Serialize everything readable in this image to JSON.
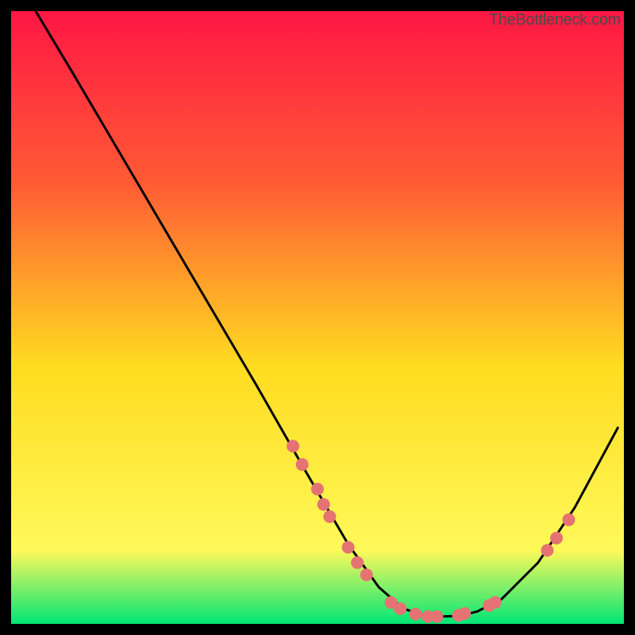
{
  "watermark": "TheBottleneck.com",
  "chart_data": {
    "type": "line",
    "title": "",
    "xlabel": "",
    "ylabel": "",
    "xlim": [
      0,
      100
    ],
    "ylim": [
      0,
      100
    ],
    "grid": false,
    "legend": false,
    "gradient_background": {
      "top_color": "#ff1744",
      "mid_top_color": "#ff5b34",
      "mid_color": "#ffdc20",
      "mid_bot_color": "#fff95a",
      "bottom_color": "#00e676"
    },
    "series": [
      {
        "name": "bottleneck-curve",
        "color": "#000000",
        "x": [
          4,
          10,
          20,
          30,
          40,
          48,
          55,
          60,
          64,
          67,
          70,
          73,
          76,
          80,
          86,
          92,
          99
        ],
        "y": [
          100,
          90,
          73,
          56,
          39,
          25,
          13,
          6,
          2.5,
          1.5,
          1.2,
          1.3,
          2,
          4,
          10,
          19,
          32
        ]
      }
    ],
    "markers": [
      {
        "name": "data-points",
        "color": "#e57373",
        "radius": 8,
        "points": [
          {
            "x": 46,
            "y": 29
          },
          {
            "x": 47.5,
            "y": 26
          },
          {
            "x": 50,
            "y": 22
          },
          {
            "x": 51,
            "y": 19.5
          },
          {
            "x": 52,
            "y": 17.5
          },
          {
            "x": 55,
            "y": 12.5
          },
          {
            "x": 56.5,
            "y": 10
          },
          {
            "x": 58,
            "y": 8
          },
          {
            "x": 62,
            "y": 3.5
          },
          {
            "x": 63.5,
            "y": 2.5
          },
          {
            "x": 66,
            "y": 1.6
          },
          {
            "x": 68,
            "y": 1.2
          },
          {
            "x": 69.5,
            "y": 1.2
          },
          {
            "x": 73,
            "y": 1.4
          },
          {
            "x": 74,
            "y": 1.7
          },
          {
            "x": 78,
            "y": 3
          },
          {
            "x": 79,
            "y": 3.5
          },
          {
            "x": 87.5,
            "y": 12
          },
          {
            "x": 89,
            "y": 14
          },
          {
            "x": 91,
            "y": 17
          }
        ]
      }
    ]
  }
}
